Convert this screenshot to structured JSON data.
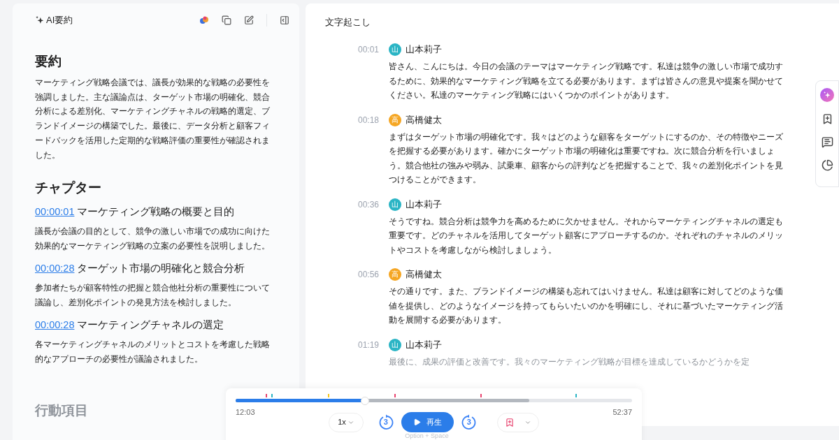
{
  "summary_panel": {
    "title": "AI要約",
    "summary_heading": "要約",
    "summary_text": "マーケティング戦略会議では、議長が効果的な戦略の必要性を強調しました。主な議論点は、ターゲット市場の明確化、競合分析による差別化、マーケティングチャネルの戦略的選定、ブランドイメージの構築でした。最後に、データ分析と顧客フィードバックを活用した定期的な戦略評価の重要性が確認されました。",
    "chapters_heading": "チャプター",
    "chapters": [
      {
        "time": "00:00:01",
        "title": "マーケティング戦略の概要と目的",
        "text": "議長が会議の目的として、競争の激しい市場での成功に向けた効果的なマーケティング戦略の立案の必要性を説明しました。"
      },
      {
        "time": "00:00:28",
        "title": "ターゲット市場の明確化と競合分析",
        "text": "参加者たちが顧客特性の把握と競合他社分析の重要性について議論し、差別化ポイントの発見方法を検討しました。"
      },
      {
        "time": "00:00:28",
        "title": "マーケティングチャネルの選定",
        "text": "各マーケティングチャネルのメリットとコストを考慮した戦略的なアプローチの必要性が議論されました。"
      }
    ],
    "action_heading": "行動項目"
  },
  "transcript": {
    "title": "文字起こし",
    "entries": [
      {
        "time": "00:01",
        "initial": "山",
        "speaker": "山本莉子",
        "color": "#2bb5c5",
        "faded": false,
        "text": "皆さん、こんにちは。今日の会議のテーマはマーケティング戦略です。私達は競争の激しい市場で成功するために、効果的なマーケティング戦略を立てる必要があります。まずは皆さんの意見や提案を聞かせてください。私達のマーケティング戦略にはいくつかのポイントがあります。"
      },
      {
        "time": "00:18",
        "initial": "高",
        "speaker": "高橋健太",
        "color": "#f5a623",
        "faded": false,
        "text": "まずはターゲット市場の明確化です。我々はどのような顧客をターゲットにするのか、その特徴やニーズを把握する必要があります。確かにターゲット市場の明確化は重要ですね。次に競合分析を行いましょう。競合他社の強みや弱み、試乗車、顧客からの評判などを把握することで、我々の差別化ポイントを見つけることができます。"
      },
      {
        "time": "00:36",
        "initial": "山",
        "speaker": "山本莉子",
        "color": "#2bb5c5",
        "faded": false,
        "text": "そうですね。競合分析は競争力を高めるために欠かせません。それからマーケティングチャネルの選定も重要です。どのチャネルを活用してターゲット顧客にアプローチするのか。それぞれのチャネルのメリットやコストを考慮しながら検討しましょう。"
      },
      {
        "time": "00:56",
        "initial": "高",
        "speaker": "高橋健太",
        "color": "#f5a623",
        "faded": false,
        "text": "その通りです。また、ブランドイメージの構築も忘れてはいけません。私達は顧客に対してどのような価値を提供し、どのようなイメージを持ってもらいたいのかを明確にし、それに基づいたマーケティング活動を展開する必要があります。"
      },
      {
        "time": "01:19",
        "initial": "山",
        "speaker": "山本莉子",
        "color": "#2bb5c5",
        "faded": true,
        "text": "最後に、成果の評価と改善です。我々のマーケティング戦略が目標を達成しているかどうかを定"
      }
    ]
  },
  "player": {
    "level": 0.326,
    "buffer": {
      "level": 0.74
    },
    "markers": [
      {
        "level": 0.075,
        "color": "#e8436f"
      },
      {
        "level": 0.09,
        "color": "#2bb5c5"
      },
      {
        "level": 0.232,
        "color": "#f5c518"
      },
      {
        "level": 0.4,
        "color": "#e8436f"
      },
      {
        "level": 0.617,
        "color": "#e8436f"
      },
      {
        "level": 0.858,
        "color": "#2bb5c5"
      }
    ],
    "current_time": "12:03",
    "total_time": "52:37",
    "speed": "1x",
    "rewind": "3",
    "play": "再生",
    "forward": "3",
    "shortcut": "Option + Space"
  }
}
